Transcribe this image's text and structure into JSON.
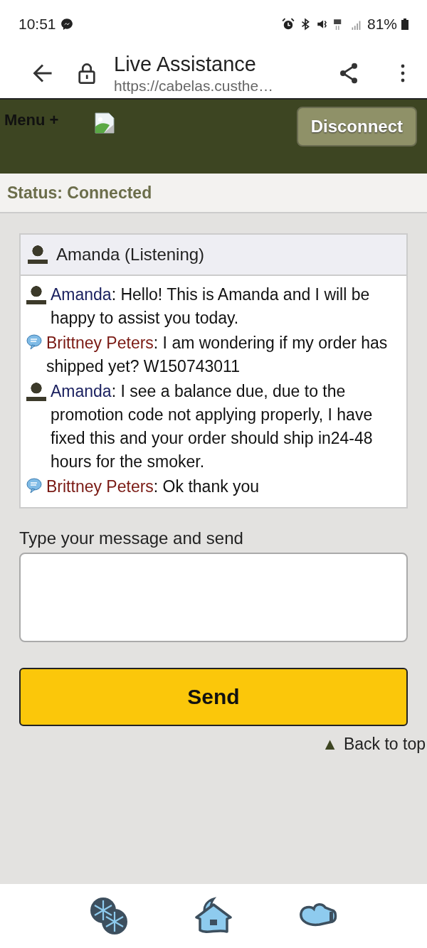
{
  "status_bar": {
    "time": "10:51",
    "battery": "81%"
  },
  "browser": {
    "title": "Live Assistance",
    "url": "https://cabelas.custhe…"
  },
  "header": {
    "menu": "Menu +",
    "disconnect_button": "Disconnect"
  },
  "connection_status": "Status: Connected",
  "chat": {
    "participant": "Amanda (Listening)",
    "messages": [
      {
        "kind": "agent",
        "sender": "Amanda",
        "text": ": Hello! This is Amanda and I will be happy to assist you today."
      },
      {
        "kind": "customer",
        "sender": "Brittney Peters",
        "text": ": I am wondering if my order has shipped yet? W150743011"
      },
      {
        "kind": "agent",
        "sender": "Amanda",
        "text": ": I see a balance due, due to the promotion code not applying properly, I have fixed this and your order should ship in24-48 hours for the smoker."
      },
      {
        "kind": "customer",
        "sender": "Brittney Peters",
        "text": ": Ok thank you"
      }
    ]
  },
  "compose": {
    "label": "Type your message and send",
    "send_button": "Send"
  },
  "back_to_top": {
    "icon": "▲",
    "label": "Back to top"
  }
}
